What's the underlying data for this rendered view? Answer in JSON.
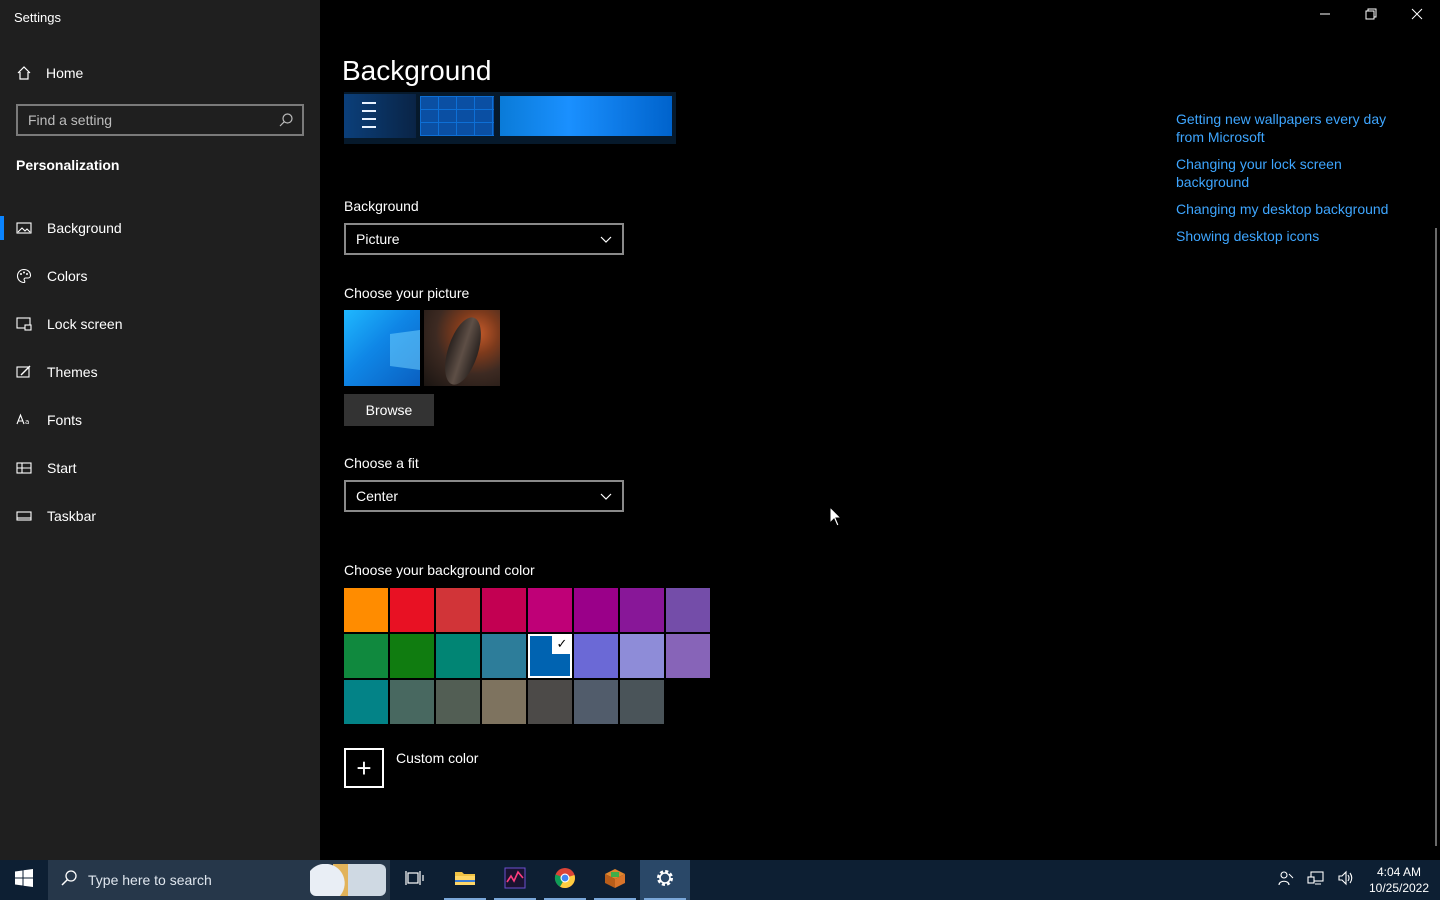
{
  "window": {
    "title": "Settings"
  },
  "sidebar": {
    "home_label": "Home",
    "search_placeholder": "Find a setting",
    "section": "Personalization",
    "items": [
      {
        "label": "Background",
        "icon": "picture-icon",
        "active": true
      },
      {
        "label": "Colors",
        "icon": "palette-icon",
        "active": false
      },
      {
        "label": "Lock screen",
        "icon": "lock-screen-icon",
        "active": false
      },
      {
        "label": "Themes",
        "icon": "themes-icon",
        "active": false
      },
      {
        "label": "Fonts",
        "icon": "fonts-icon",
        "active": false
      },
      {
        "label": "Start",
        "icon": "start-icon",
        "active": false
      },
      {
        "label": "Taskbar",
        "icon": "taskbar-icon",
        "active": false
      }
    ]
  },
  "main": {
    "title": "Background",
    "background_label": "Background",
    "background_value": "Picture",
    "choose_picture_label": "Choose your picture",
    "browse_label": "Browse",
    "fit_label": "Choose a fit",
    "fit_value": "Center",
    "color_label": "Choose your background color",
    "custom_color_label": "Custom color",
    "selected_color_index": 12,
    "colors": [
      "#ff8c00",
      "#e81123",
      "#d13438",
      "#c30052",
      "#bf0077",
      "#9a0089",
      "#881798",
      "#744da9",
      "#10893e",
      "#107c10",
      "#018574",
      "#2d7d9a",
      "#0063b1",
      "#6b69d6",
      "#8e8cd8",
      "#8764b8",
      "#038387",
      "#486860",
      "#525e54",
      "#7e735f",
      "#4c4a48",
      "#515c6b",
      "#4a5459"
    ]
  },
  "related_links": [
    "Getting new wallpapers every day from Microsoft",
    "Changing your lock screen background",
    "Changing my desktop background",
    "Showing desktop icons"
  ],
  "taskbar": {
    "search_placeholder": "Type here to search",
    "time": "4:04 AM",
    "date": "10/25/2022"
  }
}
